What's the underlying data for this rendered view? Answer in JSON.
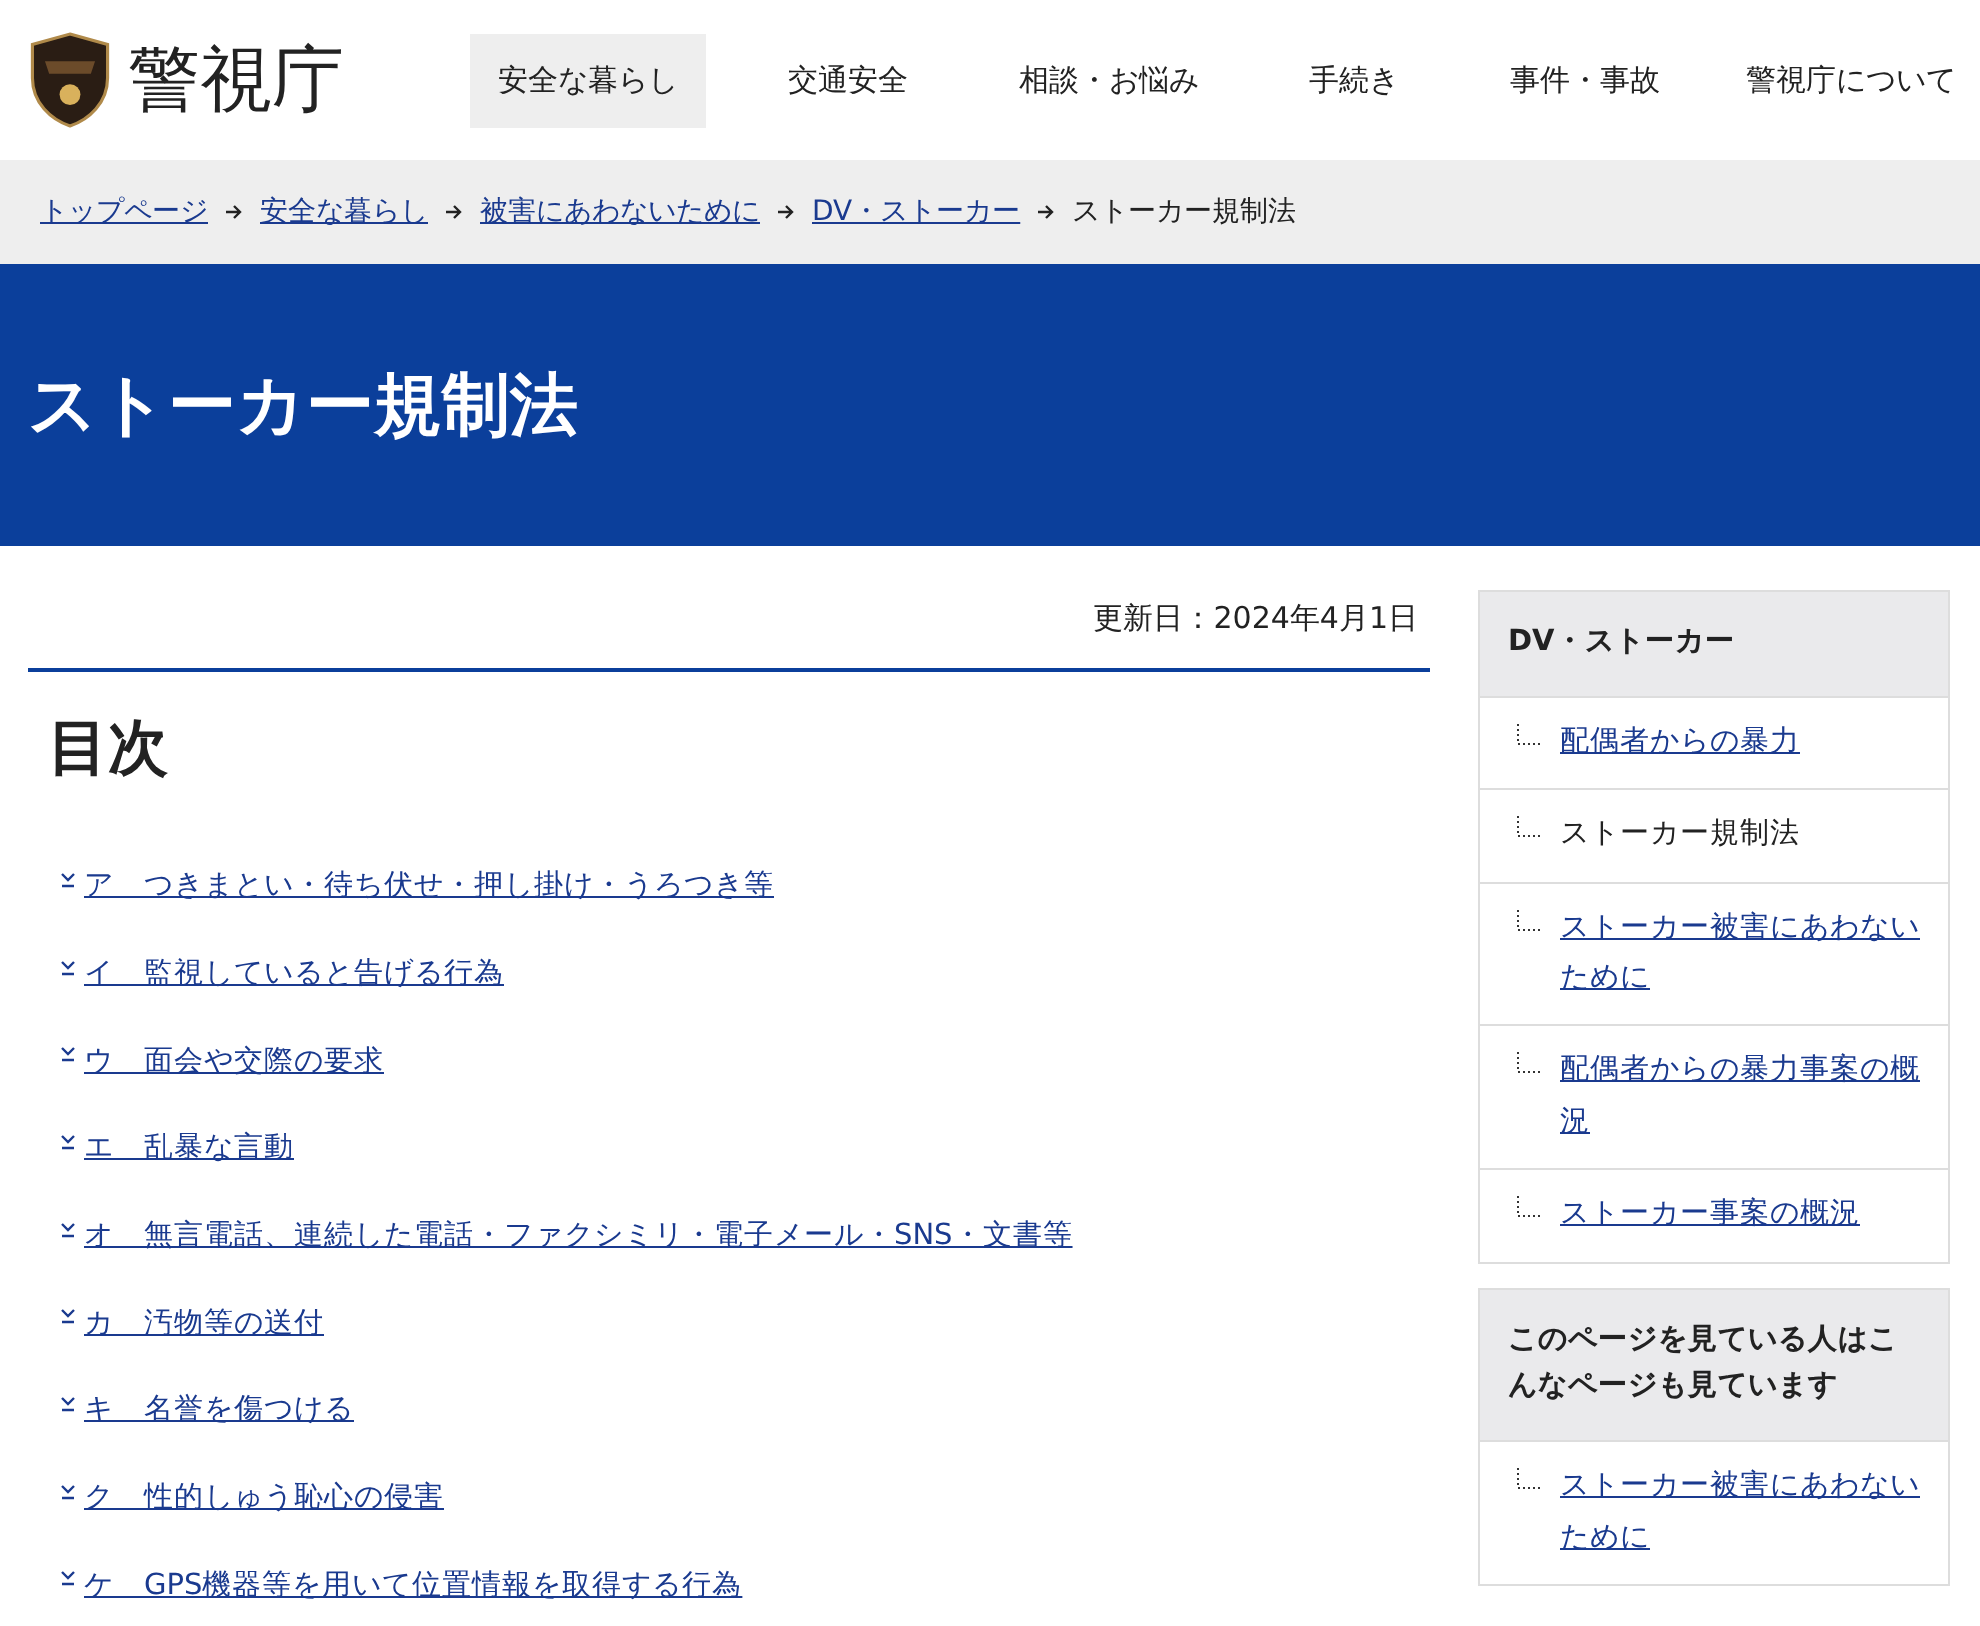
{
  "header": {
    "site_name": "警視庁",
    "nav": [
      {
        "label": "安全な暮らし",
        "selected": true
      },
      {
        "label": "交通安全",
        "selected": false
      },
      {
        "label": "相談・お悩み",
        "selected": false
      },
      {
        "label": "手続き",
        "selected": false
      },
      {
        "label": "事件・事故",
        "selected": false
      },
      {
        "label": "警視庁について",
        "selected": false
      }
    ]
  },
  "breadcrumb": [
    {
      "label": "トップページ",
      "selected": false
    },
    {
      "label": "安全な暮らし",
      "selected": false
    },
    {
      "label": "被害にあわないために",
      "selected": false
    },
    {
      "label": "DV・ストーカー",
      "selected": false
    },
    {
      "label": "ストーカー規制法",
      "selected": true
    }
  ],
  "page_title": "ストーカー規制法",
  "updated": "更新日：2024年4月1日",
  "toc": {
    "heading": "目次",
    "items": [
      "ア　つきまとい・待ち伏せ・押し掛け・うろつき等",
      "イ　監視していると告げる行為",
      "ウ　面会や交際の要求",
      "エ　乱暴な言動",
      "オ　無言電話、連続した電話・ファクシミリ・電子メール・SNS・文書等",
      "カ　汚物等の送付",
      "キ　名誉を傷つける",
      "ク　性的しゅう恥心の侵害",
      "ケ　GPS機器等を用いて位置情報を取得する行為"
    ]
  },
  "sidebar": [
    {
      "heading": "DV・ストーカー",
      "items": [
        {
          "label": "配偶者からの暴力",
          "selected": false
        },
        {
          "label": "ストーカー規制法",
          "selected": true
        },
        {
          "label": "ストーカー被害にあわないために",
          "selected": false
        },
        {
          "label": "配偶者からの暴力事案の概況",
          "selected": false
        },
        {
          "label": "ストーカー事案の概況",
          "selected": false
        }
      ]
    },
    {
      "heading": "このページを見ている人はこんなページも見ています",
      "items": [
        {
          "label": "ストーカー被害にあわないために",
          "selected": false
        }
      ]
    }
  ]
}
